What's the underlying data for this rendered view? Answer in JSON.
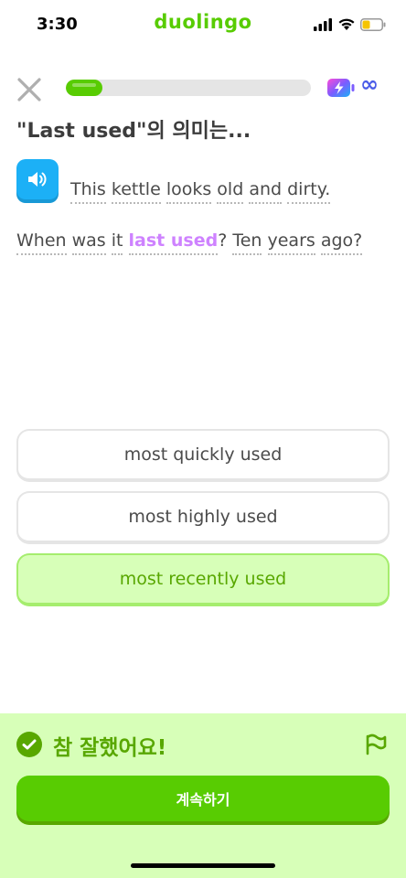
{
  "status_bar": {
    "time": "3:30",
    "brand": "duolingo"
  },
  "top_bar": {
    "progress_fraction": 0.15,
    "infinity_symbol": "∞",
    "close_icon": "close-icon",
    "energy_icon": "energy-battery-icon"
  },
  "prompt": {
    "title": "\"Last used\"의 의미는...",
    "speaker_icon": "speaker-icon",
    "sentence1": [
      "This",
      "kettle",
      "looks",
      "old",
      "and",
      "dirty."
    ],
    "sentence2": {
      "before": [
        "When",
        "was",
        "it"
      ],
      "highlight": "last used",
      "after_punct": "?",
      "after": [
        "Ten",
        "years",
        "ago?"
      ]
    }
  },
  "options": [
    {
      "label": "most quickly used",
      "state": "default"
    },
    {
      "label": "most highly used",
      "state": "default"
    },
    {
      "label": "most recently used",
      "state": "correct"
    }
  ],
  "feedback": {
    "title": "참 잘했어요!",
    "continue_label": "계속하기",
    "check_icon": "check-circle-icon",
    "flag_icon": "flag-icon"
  },
  "colors": {
    "brand_green": "#58cc02",
    "correct_bg": "#d7ffb8",
    "correct_text": "#58a700",
    "highlight": "#ce82ff",
    "speaker_blue": "#1cb0f6"
  }
}
